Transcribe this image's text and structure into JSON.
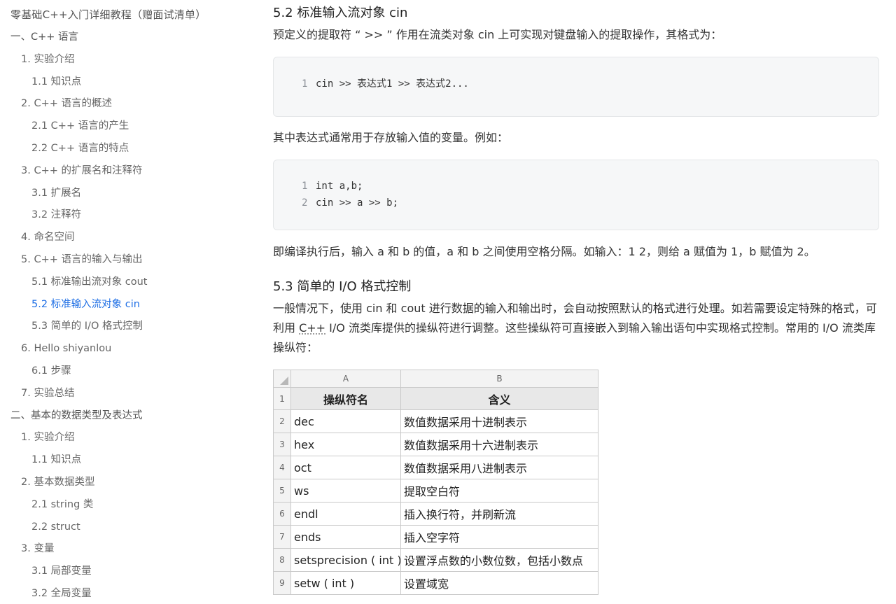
{
  "toc": {
    "title": "零基础C++入门详细教程（赠面试清单）",
    "items": [
      {
        "label": "一、C++ 语言",
        "level": 1,
        "active": false
      },
      {
        "label": "1. 实验介绍",
        "level": 2,
        "active": false
      },
      {
        "label": "1.1 知识点",
        "level": 3,
        "active": false
      },
      {
        "label": "2. C++ 语言的概述",
        "level": 2,
        "active": false
      },
      {
        "label": "2.1 C++ 语言的产生",
        "level": 3,
        "active": false
      },
      {
        "label": "2.2 C++ 语言的特点",
        "level": 3,
        "active": false
      },
      {
        "label": "3. C++ 的扩展名和注释符",
        "level": 2,
        "active": false
      },
      {
        "label": "3.1 扩展名",
        "level": 3,
        "active": false
      },
      {
        "label": "3.2 注释符",
        "level": 3,
        "active": false
      },
      {
        "label": "4. 命名空间",
        "level": 2,
        "active": false
      },
      {
        "label": "5. C++ 语言的输入与输出",
        "level": 2,
        "active": false
      },
      {
        "label": "5.1 标准输出流对象 cout",
        "level": 3,
        "active": false
      },
      {
        "label": "5.2 标准输入流对象 cin",
        "level": 3,
        "active": true
      },
      {
        "label": "5.3 简单的 I/O 格式控制",
        "level": 3,
        "active": false
      },
      {
        "label": "6. Hello shiyanlou",
        "level": 2,
        "active": false
      },
      {
        "label": "6.1 步骤",
        "level": 3,
        "active": false
      },
      {
        "label": "7. 实验总结",
        "level": 2,
        "active": false
      },
      {
        "label": "二、基本的数据类型及表达式",
        "level": 1,
        "active": false
      },
      {
        "label": "1. 实验介绍",
        "level": 2,
        "active": false
      },
      {
        "label": "1.1 知识点",
        "level": 3,
        "active": false
      },
      {
        "label": "2. 基本数据类型",
        "level": 2,
        "active": false
      },
      {
        "label": "2.1 string 类",
        "level": 3,
        "active": false
      },
      {
        "label": "2.2 struct",
        "level": 3,
        "active": false
      },
      {
        "label": "3. 变量",
        "level": 2,
        "active": false
      },
      {
        "label": "3.1 局部变量",
        "level": 3,
        "active": false
      },
      {
        "label": "3.2 全局变量",
        "level": 3,
        "active": false
      }
    ]
  },
  "content": {
    "section_52_title": "5.2 标准输入流对象 cin",
    "para1": "预定义的提取符 “ >> ” 作用在流类对象 cin 上可实现对键盘输入的提取操作，其格式为：",
    "code1": [
      {
        "ln": "1",
        "code": "cin >> 表达式1 >> 表达式2..."
      }
    ],
    "para2": "其中表达式通常用于存放输入值的变量。例如：",
    "code2": [
      {
        "ln": "1",
        "code": "int a,b;"
      },
      {
        "ln": "2",
        "code": "cin >> a >> b;"
      }
    ],
    "para3": "即编译执行后，输入 a 和 b 的值，a 和 b 之间使用空格分隔。如输入：1 2，则给 a 赋值为 1，b 赋值为 2。",
    "section_53_title": "5.3 简单的 I/O 格式控制",
    "para4_a": "一般情况下，使用 cin 和 cout 进行数据的输入和输出时，会自动按照默认的格式进行处理。如若需要设定特殊的格式，可利用 ",
    "para4_cpp": "C++",
    "para4_b": " I/O 流类库提供的操纵符进行调整。这些操纵符可直接嵌入到输入输出语句中实现格式控制。常用的 I/O 流类库操纵符："
  },
  "sheet": {
    "col_headers": [
      "A",
      "B"
    ],
    "header_row": {
      "row": "1",
      "a": "操纵符名",
      "b": "含义"
    },
    "rows": [
      {
        "row": "2",
        "a": "dec",
        "b": "数值数据采用十进制表示"
      },
      {
        "row": "3",
        "a": "hex",
        "b": "数值数据采用十六进制表示"
      },
      {
        "row": "4",
        "a": "oct",
        "b": "数值数据采用八进制表示"
      },
      {
        "row": "5",
        "a": "ws",
        "b": "提取空白符"
      },
      {
        "row": "6",
        "a": "endl",
        "b": "插入换行符，并刷新流"
      },
      {
        "row": "7",
        "a": "ends",
        "b": "插入空字符"
      },
      {
        "row": "8",
        "a": "setsprecision ( int )",
        "b": "设置浮点数的小数位数，包括小数点"
      },
      {
        "row": "9",
        "a": "setw ( int )",
        "b": "设置域宽"
      }
    ]
  },
  "colors": {
    "active_link": "#1f6fe5",
    "code_bg": "#f6f7f8",
    "table_header_bg": "#e8e8e8"
  }
}
